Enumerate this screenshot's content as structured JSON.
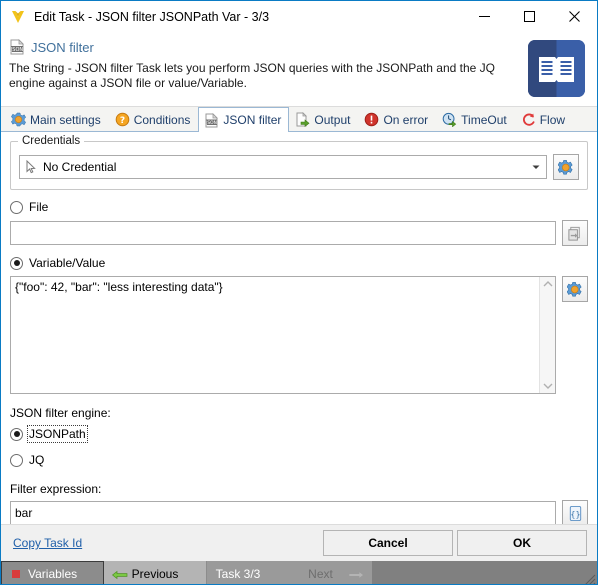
{
  "window": {
    "title": "Edit Task - JSON filter JSONPath Var - 3/3",
    "logo_icon": "vistual-v-logo-icon",
    "minimize_icon": "minimize-icon",
    "maximize_icon": "maximize-icon",
    "close_icon": "close-icon"
  },
  "header": {
    "icon": "json-document-icon",
    "title": "JSON filter",
    "description": "The String - JSON filter Task lets you perform JSON queries with the JSONPath and the JQ engine against a JSON file or value/Variable.",
    "art_icon": "open-book-icon",
    "title_color": "#41719c"
  },
  "tabs": [
    {
      "label": "Main settings",
      "icon": "gear-icon",
      "active": false
    },
    {
      "label": "Conditions",
      "icon": "question-mark-icon",
      "active": false
    },
    {
      "label": "JSON filter",
      "icon": "json-document-icon",
      "active": true
    },
    {
      "label": "Output",
      "icon": "output-arrow-icon",
      "active": false
    },
    {
      "label": "On error",
      "icon": "error-exclamation-icon",
      "active": false
    },
    {
      "label": "TimeOut",
      "icon": "clock-refresh-icon",
      "active": false
    },
    {
      "label": "Flow",
      "icon": "flow-loop-icon",
      "active": false
    }
  ],
  "credentials": {
    "legend": "Credentials",
    "selected": "No Credential",
    "cursor_icon": "mouse-pointer-icon",
    "dropdown_icon": "chevron-down-icon",
    "settings_button_icon": "gear-settings-icon"
  },
  "source": {
    "file_radio_label": "File",
    "file_radio_checked": false,
    "file_path": "",
    "file_browse_icon": "file-browse-icon",
    "variable_radio_label": "Variable/Value",
    "variable_radio_checked": true,
    "variable_value": "{\"foo\": 42, \"bar\": \"less interesting data\"}",
    "variable_settings_icon": "gear-settings-icon",
    "scroll_up_icon": "chevron-up-icon",
    "scroll_down_icon": "chevron-down-icon"
  },
  "engine": {
    "label": "JSON filter engine:",
    "options": [
      {
        "label": "JSONPath",
        "checked": true,
        "focused": true
      },
      {
        "label": "JQ",
        "checked": false,
        "focused": false
      }
    ]
  },
  "filter": {
    "label": "Filter expression:",
    "value": "bar",
    "braces_button_icon": "curly-braces-icon"
  },
  "footer": {
    "copy_task_id": "Copy Task Id",
    "cancel_label": "Cancel",
    "ok_label": "OK"
  },
  "statusbar": {
    "variables_label": "Variables",
    "variables_icon": "red-square-icon",
    "previous_label": "Previous",
    "previous_icon": "arrow-left-icon",
    "task_label": "Task 3/3",
    "next_label": "Next",
    "next_icon": "arrow-right-icon",
    "next_disabled": true,
    "resize_grip_icon": "resize-grip-icon"
  }
}
